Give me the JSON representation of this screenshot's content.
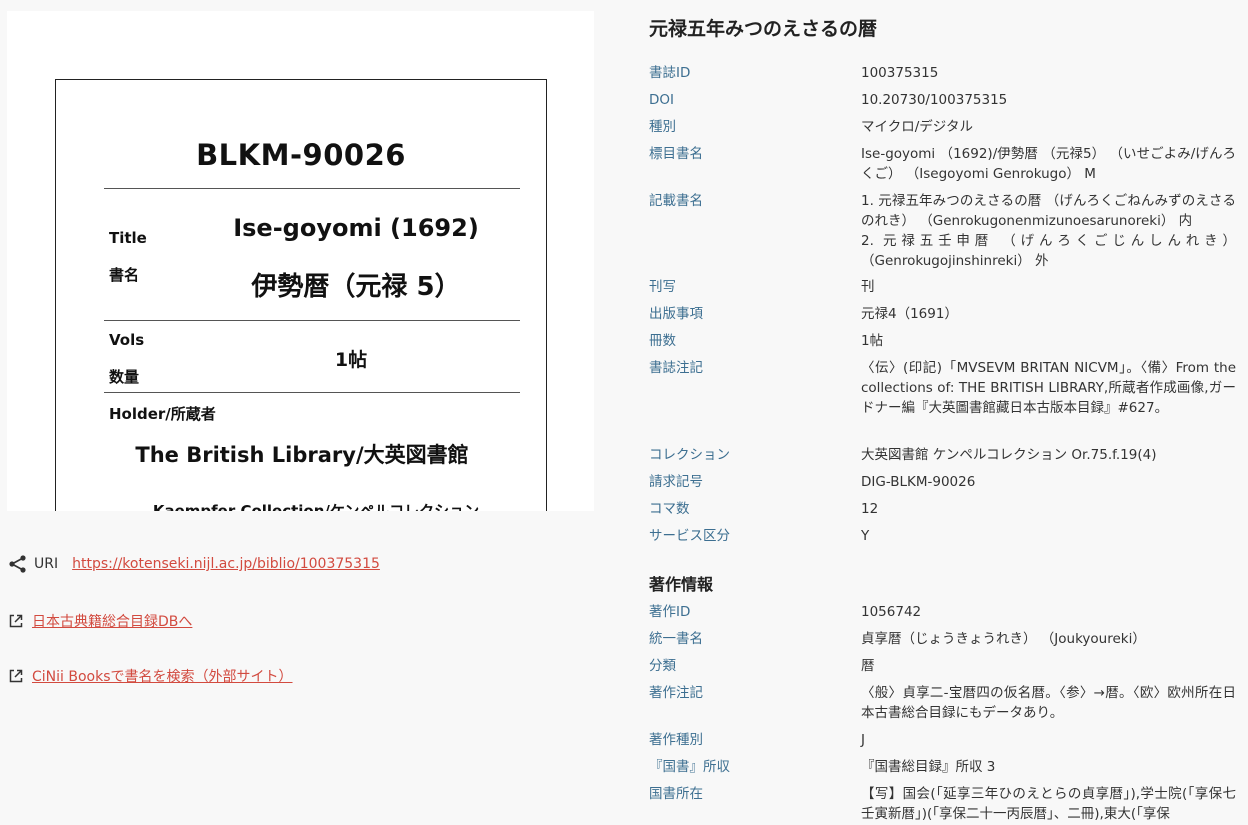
{
  "title": "元禄五年みつのえさるの暦",
  "card": {
    "code": "BLKM-90026",
    "title_label": "Title",
    "title_value": "Ise-goyomi (1692)",
    "shomei_label": "書名",
    "shomei_value": "伊勢暦（元禄 5）",
    "vols_label": "Vols",
    "suryo_label": "数量",
    "vols_value": "1帖",
    "holder_label": "Holder/所蔵者",
    "holder_value": "The British Library/大英図書館",
    "collection": "Kaempfer Collection/ケンペルコレクション"
  },
  "links": {
    "uri_label": "URI",
    "uri_value": "https://kotenseki.nijl.ac.jp/biblio/100375315",
    "db_link": "日本古典籍総合目録DBへ",
    "cinii_link": "CiNii Booksで書名を検索（外部サイト）"
  },
  "icons": {
    "share": "share-icon",
    "external": "external-link-icon"
  },
  "colors": {
    "link": "#d24a3f",
    "key": "#3d6f91"
  },
  "bib": [
    {
      "key": "書誌ID",
      "value": "100375315"
    },
    {
      "key": "DOI",
      "value": "10.20730/100375315"
    },
    {
      "key": "種別",
      "value": "マイクロ/デジタル"
    },
    {
      "key": "標目書名",
      "value": "Ise-goyomi （1692)/伊勢暦 （元禄5） （いせごよみ/げんろくご） （Isegoyomi Genrokugo） M"
    },
    {
      "key": "記載書名",
      "value": "1. 元禄五年みつのえさるの暦 （げんろくごねんみずのえさるのれき） （Genrokugonenmizunoesarunoreki） 内\n2. 元禄五壬申暦 （げんろくごじんしんれき） （Genrokugojinshinreki） 外"
    },
    {
      "key": "刊写",
      "value": "刊"
    },
    {
      "key": "出版事項",
      "value": "元禄4（1691）"
    },
    {
      "key": "冊数",
      "value": "1帖"
    },
    {
      "key": "書誌注記",
      "value": "〈伝〉(印記)「MVSEVM BRITAN NICVM」。〈備〉From the collections of: THE BRITISH LIBRARY,所蔵者作成画像,ガードナー編『大英圖書館藏日本古版本目録』#627。"
    },
    {
      "key": "コレクション",
      "value": "大英図書館 ケンペルコレクション Or.75.f.19(4)"
    },
    {
      "key": "請求記号",
      "value": "DIG-BLKM-90026"
    },
    {
      "key": "コマ数",
      "value": "12"
    },
    {
      "key": "サービス区分",
      "value": "Y"
    }
  ],
  "work_section_title": "著作情報",
  "work": [
    {
      "key": "著作ID",
      "value": "1056742"
    },
    {
      "key": "統一書名",
      "value": "貞享暦（じょうきょうれき） （Joukyoureki）"
    },
    {
      "key": "分類",
      "value": "暦"
    },
    {
      "key": "著作注記",
      "value": "〈般〉貞享二-宝暦四の仮名暦。〈参〉→暦。〈欧〉欧州所在日本古書総合目録にもデータあり。"
    },
    {
      "key": "著作種別",
      "value": "J"
    },
    {
      "key": "『国書』所収",
      "value": "『国書総目録』所収 3"
    },
    {
      "key": "国書所在",
      "value": "【写】国会(「延享三年ひのえとらの貞享暦」),学士院(「享保七壬寅新暦」)(「享保二十一丙辰暦」、二冊),東大(「享保"
    }
  ]
}
